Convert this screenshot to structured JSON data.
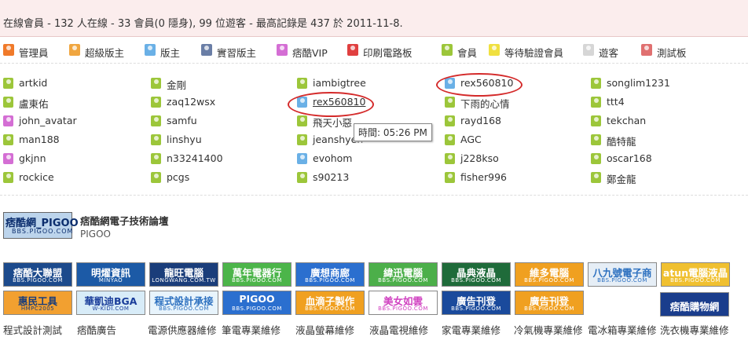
{
  "header": {
    "text": "在線會員 - 132 人在線 - 33 會員(0 隱身), 99 位遊客 - 最高記錄是 437 於 2011-11-8."
  },
  "legend": [
    {
      "label": "管理員",
      "icon": "admin-user-icon",
      "color": "#f07a2a"
    },
    {
      "label": "超級版主",
      "icon": "super-moderator-icon",
      "color": "#f0a640"
    },
    {
      "label": "版主",
      "icon": "moderator-icon",
      "color": "#6ab0e6"
    },
    {
      "label": "實習版主",
      "icon": "intern-moderator-icon",
      "color": "#6a7ea6"
    },
    {
      "label": "痞酷VIP",
      "icon": "vip-user-icon",
      "color": "#d46ed4"
    },
    {
      "label": "印刷電路板",
      "icon": "pcb-user-icon",
      "color": "#e04040"
    },
    {
      "label": "會員",
      "icon": "member-icon",
      "color": "#9cc63a"
    },
    {
      "label": "等待驗證會員",
      "icon": "pending-member-icon",
      "color": "#f0e040"
    },
    {
      "label": "遊客",
      "icon": "guest-icon",
      "color": "#d6d6d6"
    },
    {
      "label": "測試板",
      "icon": "test-board-icon",
      "color": "#e07070"
    }
  ],
  "users": [
    [
      {
        "name": "artkid",
        "type": "member"
      },
      {
        "name": "盧東佑",
        "type": "member"
      },
      {
        "name": "john_avatar",
        "type": "vip"
      },
      {
        "name": "man188",
        "type": "member"
      },
      {
        "name": "gkjnn",
        "type": "vip"
      },
      {
        "name": "rockice",
        "type": "member"
      }
    ],
    [
      {
        "name": "金剛",
        "type": "member"
      },
      {
        "name": "zaq12wsx",
        "type": "member"
      },
      {
        "name": "samfu",
        "type": "member"
      },
      {
        "name": "linshyu",
        "type": "member"
      },
      {
        "name": "n33241400",
        "type": "member"
      },
      {
        "name": "pcgs",
        "type": "member"
      }
    ],
    [
      {
        "name": "iambigtree",
        "type": "member"
      },
      {
        "name": "rex560810",
        "type": "moderator",
        "underline": true
      },
      {
        "name": "飛天小惡",
        "type": "member"
      },
      {
        "name": "jeanshyen",
        "type": "member"
      },
      {
        "name": "evohom",
        "type": "moderator"
      },
      {
        "name": "s90213",
        "type": "member"
      }
    ],
    [
      {
        "name": "rex560810",
        "type": "moderator"
      },
      {
        "name": "下雨的心情",
        "type": "member"
      },
      {
        "name": "rayd168",
        "type": "member"
      },
      {
        "name": "AGC",
        "type": "member"
      },
      {
        "name": "j228kso",
        "type": "member"
      },
      {
        "name": "fisher996",
        "type": "member"
      }
    ],
    [
      {
        "name": "songlim1231",
        "type": "member"
      },
      {
        "name": "ttt4",
        "type": "member"
      },
      {
        "name": "tekchan",
        "type": "member"
      },
      {
        "name": "酷特龍",
        "type": "member"
      },
      {
        "name": "oscar168",
        "type": "member"
      },
      {
        "name": "鄭金龍",
        "type": "member"
      }
    ]
  ],
  "tooltip": "時間: 05:26 PM",
  "forum": {
    "logo_text": "痞酷網_PIGOO",
    "logo_sub": "BBS.PIGOO.COM",
    "title": "痞酷網電子技術論壇",
    "subtitle": "PIGOO"
  },
  "banners": [
    {
      "title": "痞酷大聯盟",
      "sub": "BBS.PIGOO.COM",
      "bg": "#1c4a8c",
      "fg": "#ffffff"
    },
    {
      "title": "明燿資訊",
      "sub": "MINYAO",
      "bg": "#1c5aa6",
      "fg": "#ffffff"
    },
    {
      "title": "龍旺電腦",
      "sub": "LONGWANG.COM.TW",
      "bg": "#1a3d7a",
      "fg": "#ffffff"
    },
    {
      "title": "萬年電器行",
      "sub": "BBS.PIGOO.COM",
      "bg": "#4cb54a",
      "fg": "#ffffff"
    },
    {
      "title": "廣想商廊",
      "sub": "BBS.PIGOO.COM",
      "bg": "#2b6fcf",
      "fg": "#ffffff"
    },
    {
      "title": "緯迅電腦",
      "sub": "BBS.PIGOO.COM",
      "bg": "#4caf4a",
      "fg": "#ffffff"
    },
    {
      "title": "晶典液晶",
      "sub": "BBS.PIGOO.COM",
      "bg": "#1f6b3a",
      "fg": "#ffffff"
    },
    {
      "title": "維多電腦",
      "sub": "BBS.PIGOO.COM",
      "bg": "#f0a020",
      "fg": "#ffffff"
    },
    {
      "title": "八九號電子商",
      "sub": "BBS.PIGOO.COM",
      "bg": "#e6eef6",
      "fg": "#2b6fbf"
    },
    {
      "title": "atun電腦液晶",
      "sub": "BBS.PIGOO.COM",
      "bg": "#f0c030",
      "fg": "#ffffff"
    },
    {
      "title": "惠民工具",
      "sub": "HMPC2005",
      "bg": "#f2a030",
      "fg": "#1a3d7a"
    },
    {
      "title": "華凱迪BGA",
      "sub": "W-KIDI.COM",
      "bg": "#d8ecf8",
      "fg": "#1a3d9a"
    },
    {
      "title": "程式設計承接",
      "sub": "BBS.PIGOO.COM",
      "bg": "#e8f4fc",
      "fg": "#2b6fbf"
    },
    {
      "title": "PIGOO",
      "sub": "BBS.PIGOO.COM",
      "bg": "#2b6fcf",
      "fg": "#ffffff"
    },
    {
      "title": "血滴子製作",
      "sub": "BBS.PIGOO.COM",
      "bg": "#f0a020",
      "fg": "#ffffff"
    },
    {
      "title": "美女如雲",
      "sub": "BBS.PIGOO.COM",
      "bg": "#ffffff",
      "fg": "#d040c0"
    },
    {
      "title": "廣告刊登",
      "sub": "BBS.PIGOO.COM",
      "bg": "#1a4a9c",
      "fg": "#ffffff"
    },
    {
      "title": "廣告刊登",
      "sub": "BBS.PIGOO.COM",
      "bg": "#f0a020",
      "fg": "#ffffff"
    },
    {
      "title": "痞酷購物網",
      "sub": "",
      "bg": "#1a3d8c",
      "fg": "#ffffff"
    }
  ],
  "links": [
    "程式設計測試",
    "痞酷廣告",
    "電源供應器維修",
    "筆電專業維修",
    "液晶螢幕維修",
    "液晶電視維修",
    "家電專業維修",
    "冷氣機專業維修",
    "電冰箱專業維修",
    "洗衣機專業維修"
  ],
  "type_colors": {
    "member": "#9cc63a",
    "moderator": "#6ab0e6",
    "vip": "#d46ed4"
  }
}
